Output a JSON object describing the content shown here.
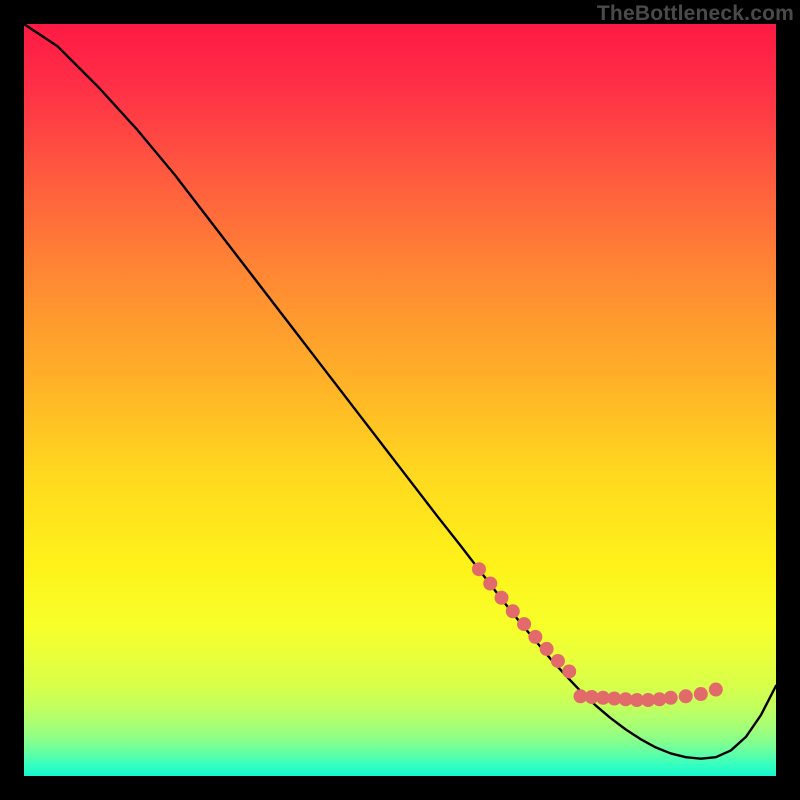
{
  "watermark": "TheBottleneck.com",
  "chart_data": {
    "type": "line",
    "title": "",
    "xlabel": "",
    "ylabel": "",
    "xlim": [
      0,
      100
    ],
    "ylim": [
      0,
      100
    ],
    "grid": false,
    "legend": false,
    "series": [
      {
        "name": "bottleneck-curve",
        "color": "#000000",
        "x": [
          0,
          4.5,
          7,
          10,
          15,
          20,
          25,
          30,
          35,
          40,
          45,
          50,
          55,
          58,
          60,
          62,
          64,
          66,
          68,
          70,
          72,
          74,
          76,
          78,
          80,
          82,
          84,
          86,
          88,
          90,
          92,
          94,
          96,
          98,
          100
        ],
        "y": [
          100,
          97,
          94.5,
          91.5,
          86,
          80,
          73.5,
          67,
          60.5,
          54,
          47.5,
          41,
          34.5,
          30.7,
          28.1,
          25.5,
          22.9,
          20.4,
          18.0,
          15.6,
          13.4,
          11.3,
          9.4,
          7.7,
          6.2,
          4.9,
          3.8,
          3.0,
          2.5,
          2.3,
          2.5,
          3.4,
          5.2,
          8.1,
          12.0
        ]
      }
    ],
    "markers": {
      "name": "optimum-band",
      "color": "#e26a6a",
      "radius_px": 7,
      "x": [
        60.5,
        62.0,
        63.5,
        65.0,
        66.5,
        68.0,
        69.5,
        71.0,
        72.5,
        74.0,
        75.5,
        77.0,
        78.5,
        80.0,
        81.5,
        83.0,
        84.5,
        86.0,
        88.0,
        90.0,
        92.0
      ],
      "y": [
        27.5,
        25.6,
        23.7,
        21.9,
        20.2,
        18.5,
        16.9,
        15.3,
        13.9,
        10.6,
        10.5,
        10.4,
        10.3,
        10.2,
        10.1,
        10.1,
        10.2,
        10.4,
        10.6,
        10.9,
        11.5
      ]
    }
  }
}
